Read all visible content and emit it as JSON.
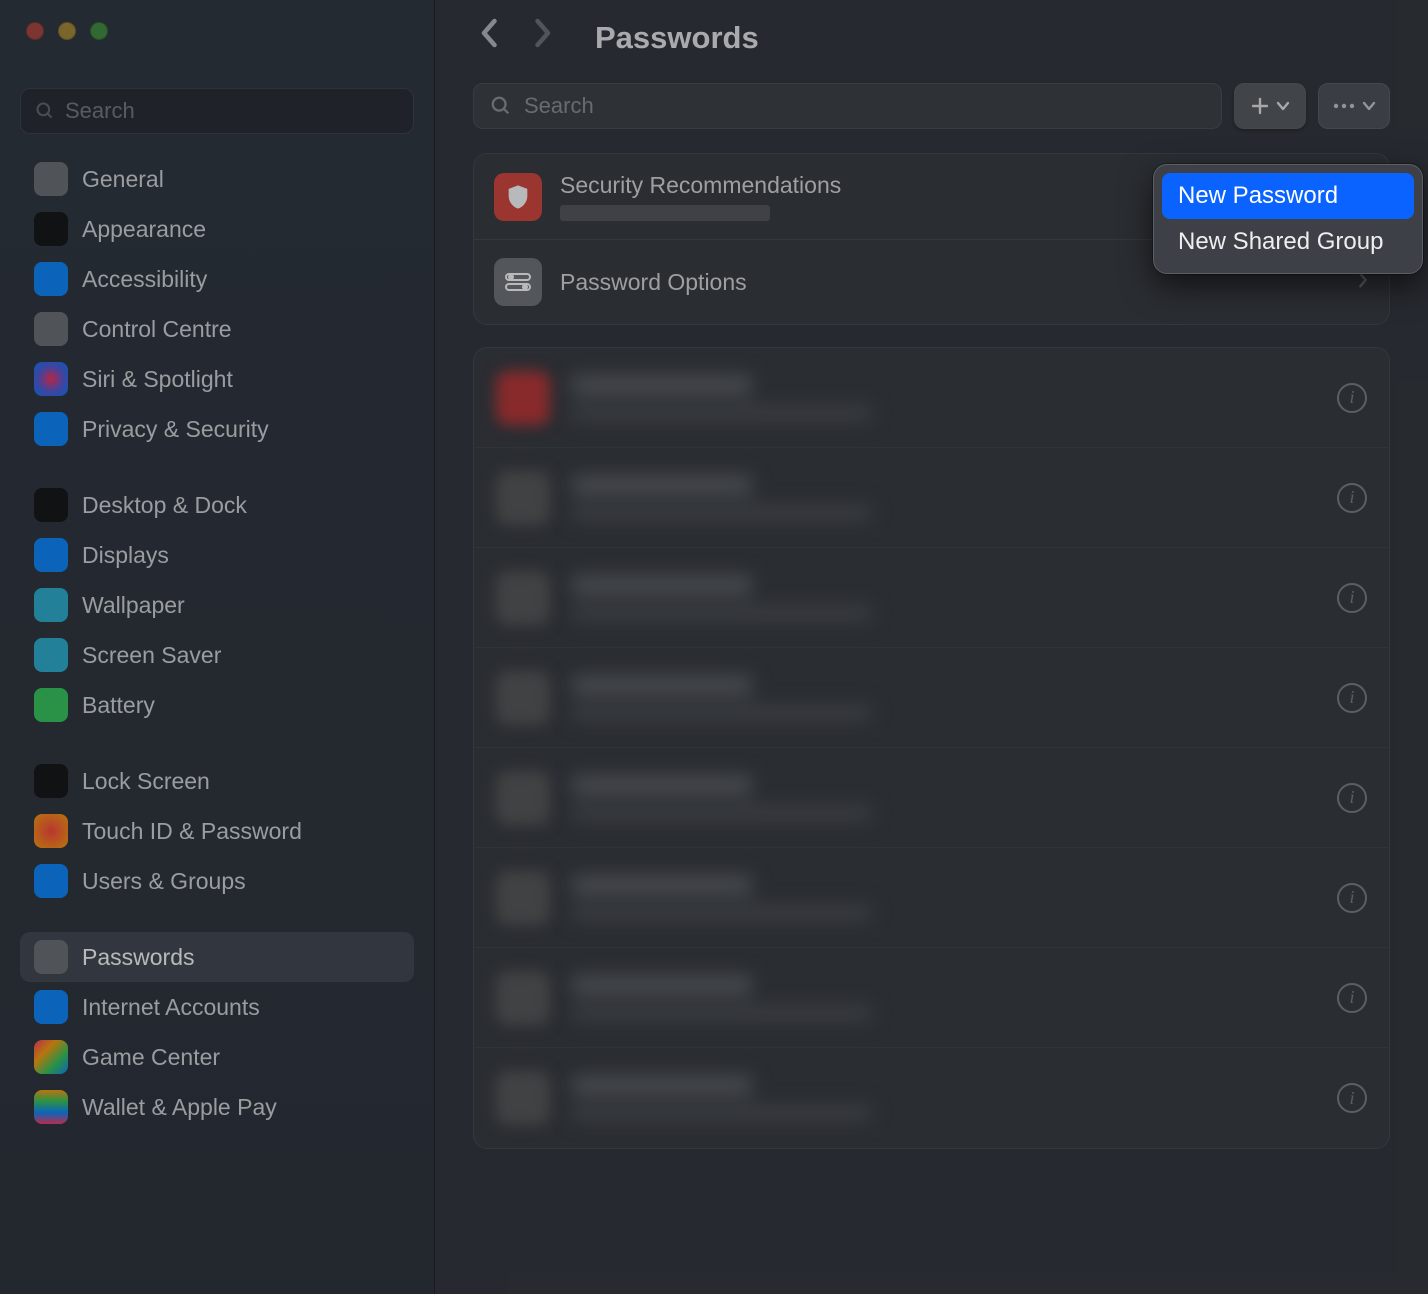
{
  "sidebar": {
    "search_placeholder": "Search",
    "groups": [
      {
        "items": [
          {
            "key": "general",
            "label": "General",
            "iconClass": "ic-general"
          },
          {
            "key": "appearance",
            "label": "Appearance",
            "iconClass": "ic-appearance"
          },
          {
            "key": "accessibility",
            "label": "Accessibility",
            "iconClass": "ic-accessibility"
          },
          {
            "key": "controlcentre",
            "label": "Control Centre",
            "iconClass": "ic-controlcentre"
          },
          {
            "key": "siri",
            "label": "Siri & Spotlight",
            "iconClass": "ic-siri"
          },
          {
            "key": "privacy",
            "label": "Privacy & Security",
            "iconClass": "ic-privacy"
          }
        ]
      },
      {
        "items": [
          {
            "key": "desktop",
            "label": "Desktop & Dock",
            "iconClass": "ic-desktop"
          },
          {
            "key": "displays",
            "label": "Displays",
            "iconClass": "ic-displays"
          },
          {
            "key": "wallpaper",
            "label": "Wallpaper",
            "iconClass": "ic-wallpaper"
          },
          {
            "key": "screensaver",
            "label": "Screen Saver",
            "iconClass": "ic-screensaver"
          },
          {
            "key": "battery",
            "label": "Battery",
            "iconClass": "ic-battery"
          }
        ]
      },
      {
        "items": [
          {
            "key": "lockscreen",
            "label": "Lock Screen",
            "iconClass": "ic-lockscreen"
          },
          {
            "key": "touchid",
            "label": "Touch ID & Password",
            "iconClass": "ic-touchid"
          },
          {
            "key": "users",
            "label": "Users & Groups",
            "iconClass": "ic-users"
          }
        ]
      },
      {
        "items": [
          {
            "key": "passwords",
            "label": "Passwords",
            "iconClass": "ic-passwords",
            "selected": true
          },
          {
            "key": "internet",
            "label": "Internet Accounts",
            "iconClass": "ic-internet"
          },
          {
            "key": "gamecenter",
            "label": "Game Center",
            "iconClass": "ic-gamecenter"
          },
          {
            "key": "wallet",
            "label": "Wallet & Apple Pay",
            "iconClass": "ic-wallet"
          }
        ]
      }
    ]
  },
  "header": {
    "back_enabled": true,
    "forward_enabled": false,
    "title": "Passwords"
  },
  "toolbar": {
    "search_placeholder": "Search",
    "add_button": "add",
    "more_button": "more"
  },
  "top_card": {
    "security_recommendations": "Security Recommendations",
    "password_options": "Password Options"
  },
  "entries_count": 8,
  "popover": {
    "items": [
      {
        "label": "New Password",
        "highlighted": true
      },
      {
        "label": "New Shared Group",
        "highlighted": false
      }
    ]
  }
}
